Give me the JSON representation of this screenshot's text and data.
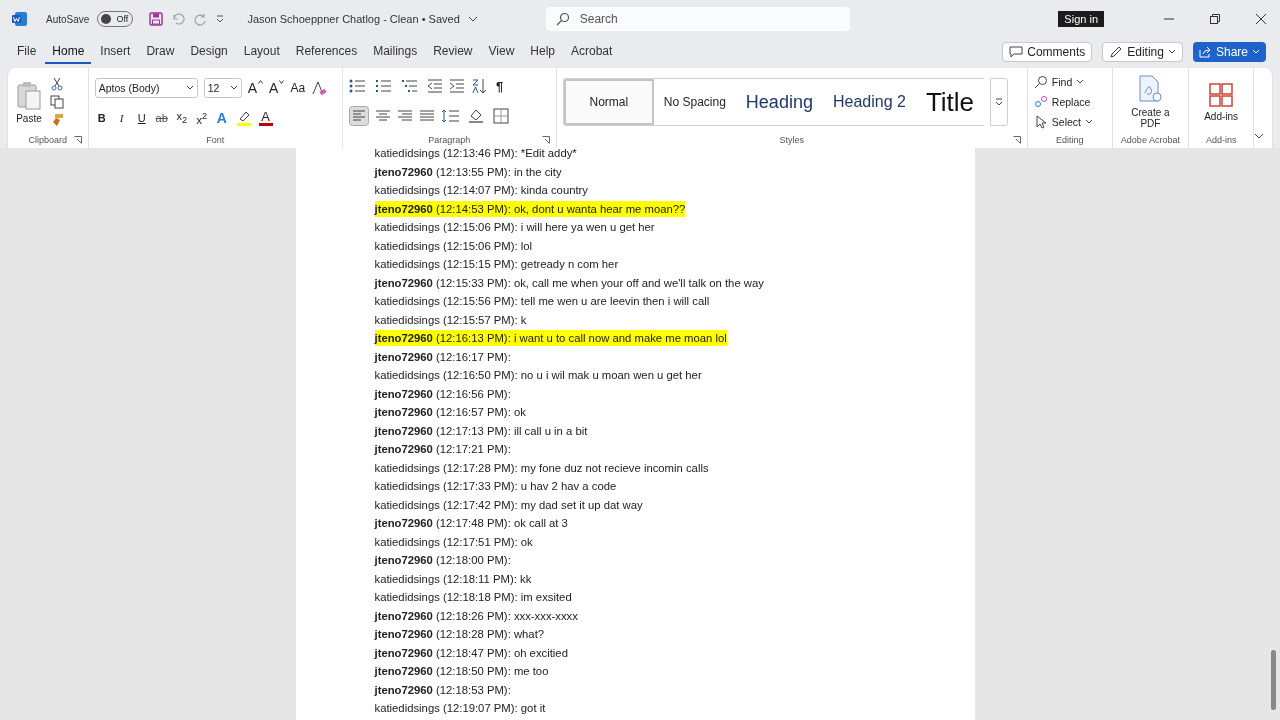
{
  "titlebar": {
    "autosave_label": "AutoSave",
    "autosave": {
      "on": false,
      "label": "Off"
    },
    "document_title": "Jason Schoeppner Chatlog - Clean • Saved",
    "search": {
      "placeholder": "Search"
    },
    "sign_in": "Sign in"
  },
  "menu_tabs": [
    {
      "label": "File",
      "selected": false
    },
    {
      "label": "Home",
      "selected": true
    },
    {
      "label": "Insert",
      "selected": false
    },
    {
      "label": "Draw",
      "selected": false
    },
    {
      "label": "Design",
      "selected": false
    },
    {
      "label": "Layout",
      "selected": false
    },
    {
      "label": "References",
      "selected": false
    },
    {
      "label": "Mailings",
      "selected": false
    },
    {
      "label": "Review",
      "selected": false
    },
    {
      "label": "View",
      "selected": false
    },
    {
      "label": "Help",
      "selected": false
    },
    {
      "label": "Acrobat",
      "selected": false
    }
  ],
  "actions": {
    "comments": "Comments",
    "editing": "Editing",
    "share": "Share"
  },
  "ribbon": {
    "clipboard": {
      "paste": "Paste",
      "group_label": "Clipboard"
    },
    "font": {
      "font_name": "Aptos (Body)",
      "font_size": "12",
      "grow": "A",
      "shrink": "A",
      "change_case": "Aa",
      "format_buttons": [
        "B",
        "I",
        "U",
        "ab",
        "x$_{2}$",
        "x$^{2}$"
      ],
      "text_effects": "A",
      "font_color": "A",
      "group_label": "Font"
    },
    "paragraph": {
      "pilcrow": "¶",
      "group_label": "Paragraph"
    },
    "styles": {
      "items": [
        {
          "label": "Normal",
          "kind": "normal",
          "selected": true
        },
        {
          "label": "No Spacing",
          "kind": "nospacing",
          "selected": false
        },
        {
          "label": "Heading",
          "kind": "heading1",
          "selected": false
        },
        {
          "label": "Heading 2",
          "kind": "heading2",
          "selected": false
        },
        {
          "label": "Title",
          "kind": "title",
          "selected": false
        }
      ],
      "group_label": "Styles"
    },
    "editing": {
      "find": "Find",
      "replace": "Replace",
      "select": "Select",
      "group_label": "Editing"
    },
    "acrobat": {
      "create_pdf": "Create a PDF",
      "group_label": "Adobe Acrobat"
    },
    "addins": {
      "label": "Add-ins",
      "group_label": "Add-ins"
    }
  },
  "document": {
    "lines": [
      {
        "author": "katiedidsings",
        "bold": false,
        "time": "(12:13:46 PM):",
        "text": "*Edit addy*",
        "highlighted": false
      },
      {
        "author": "jteno72960",
        "bold": true,
        "time": "(12:13:55 PM):",
        "text": "in the city",
        "highlighted": false
      },
      {
        "author": "katiedidsings",
        "bold": false,
        "time": "(12:14:07 PM):",
        "text": "kinda country",
        "highlighted": false
      },
      {
        "author": "jteno72960",
        "bold": true,
        "time": "(12:14:53 PM):",
        "text": "ok, dont u wanta hear me moan??",
        "highlighted": true
      },
      {
        "author": "katiedidsings",
        "bold": false,
        "time": "(12:15:06 PM):",
        "text": "i will here ya wen u get her",
        "highlighted": false
      },
      {
        "author": "katiedidsings",
        "bold": false,
        "time": "(12:15:06 PM):",
        "text": "lol",
        "highlighted": false
      },
      {
        "author": "katiedidsings",
        "bold": false,
        "time": "(12:15:15 PM):",
        "text": "getready n com her",
        "highlighted": false
      },
      {
        "author": "jteno72960",
        "bold": true,
        "time": "(12:15:33 PM):",
        "text": "ok, call me when your off and we'll talk on the way",
        "highlighted": false
      },
      {
        "author": "katiedidsings",
        "bold": false,
        "time": "(12:15:56 PM):",
        "text": "tell me wen u are leevin then i will call",
        "highlighted": false
      },
      {
        "author": "katiedidsings",
        "bold": false,
        "time": "(12:15:57 PM):",
        "text": "k",
        "highlighted": false
      },
      {
        "author": "jteno72960",
        "bold": true,
        "time": "(12:16:13 PM):",
        "text": "i want u to call now and make me moan lol",
        "highlighted": true
      },
      {
        "author": "jteno72960",
        "bold": true,
        "time": "(12:16:17 PM):",
        "highlighted": false
      },
      {
        "author": "katiedidsings",
        "bold": false,
        "time": "(12:16:50 PM):",
        "text": "no u i wil mak u moan wen u get her",
        "highlighted": false
      },
      {
        "author": "jteno72960",
        "bold": true,
        "time": "(12:16:56 PM):",
        "highlighted": false
      },
      {
        "author": "jteno72960",
        "bold": true,
        "time": "(12:16:57 PM):",
        "text": "ok",
        "highlighted": false
      },
      {
        "author": "jteno72960",
        "bold": true,
        "time": "(12:17:13 PM):",
        "text": "ill call u in a bit",
        "highlighted": false
      },
      {
        "author": "jteno72960",
        "bold": true,
        "time": "(12:17:21 PM):",
        "highlighted": false
      },
      {
        "author": "katiedidsings",
        "bold": false,
        "time": "(12:17:28 PM):",
        "text": "my fone duz not recieve incomin calls",
        "highlighted": false
      },
      {
        "author": "katiedidsings",
        "bold": false,
        "time": "(12:17:33 PM):",
        "text": "u hav 2 hav a code",
        "highlighted": false
      },
      {
        "author": "katiedidsings",
        "bold": false,
        "time": "(12:17:42 PM):",
        "text": "my dad set it up dat way",
        "highlighted": false
      },
      {
        "author": "jteno72960",
        "bold": true,
        "time": "(12:17:48 PM):",
        "text": "ok call at 3",
        "highlighted": false
      },
      {
        "author": "katiedidsings",
        "bold": false,
        "time": "(12:17:51 PM):",
        "text": "ok",
        "highlighted": false
      },
      {
        "author": "jteno72960",
        "bold": true,
        "time": "(12:18:00 PM):",
        "highlighted": false
      },
      {
        "author": "katiedidsings",
        "bold": false,
        "time": "(12:18:11 PM):",
        "text": "kk",
        "highlighted": false
      },
      {
        "author": "katiedidsings",
        "bold": false,
        "time": "(12:18:18 PM):",
        "text": "im exsited",
        "highlighted": false
      },
      {
        "author": "jteno72960",
        "bold": true,
        "time": "(12:18:26 PM):",
        "text": "xxx-xxx-xxxx",
        "highlighted": false
      },
      {
        "author": "jteno72960",
        "bold": true,
        "time": "(12:18:28 PM):",
        "text": "what?",
        "highlighted": false
      },
      {
        "author": "jteno72960",
        "bold": true,
        "time": "(12:18:47 PM):",
        "text": "oh excitied",
        "highlighted": false
      },
      {
        "author": "jteno72960",
        "bold": true,
        "time": "(12:18:50 PM):",
        "text": "me too",
        "highlighted": false
      },
      {
        "author": "jteno72960",
        "bold": true,
        "time": "(12:18:53 PM):",
        "highlighted": false
      },
      {
        "author": "katiedidsings",
        "bold": false,
        "time": "(12:19:07 PM):",
        "text": "got it",
        "highlighted": false
      }
    ]
  }
}
